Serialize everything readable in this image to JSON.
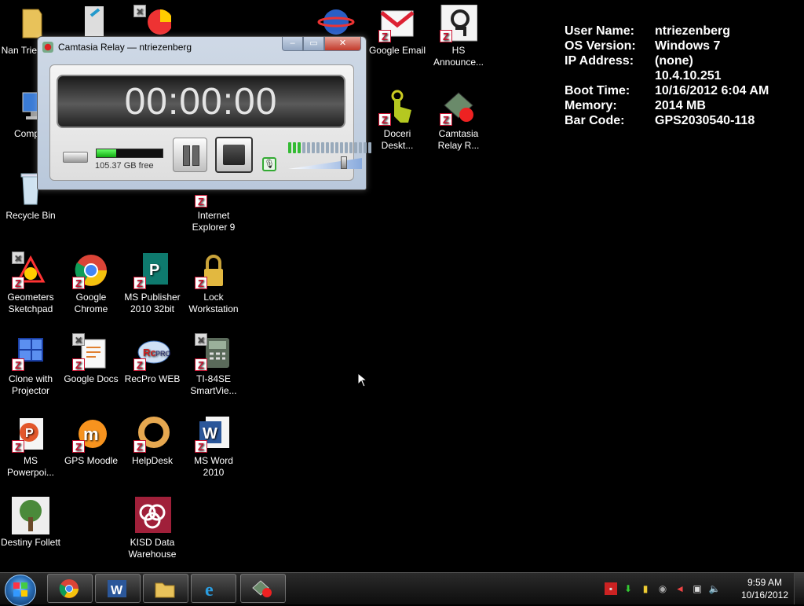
{
  "desktop": {
    "icons": [
      {
        "label": "Nan Triezen..."
      },
      {
        "label": "Comp..."
      },
      {
        "label": "Recycle Bin"
      },
      {
        "label": "Internet Explorer 9"
      },
      {
        "label": "Google Email"
      },
      {
        "label": "HS Announce..."
      },
      {
        "label": "Doceri Deskt..."
      },
      {
        "label": "Camtasia Relay R..."
      },
      {
        "label": "Geometers Sketchpad"
      },
      {
        "label": "Google Chrome"
      },
      {
        "label": "MS Publisher 2010 32bit"
      },
      {
        "label": "Lock Workstation"
      },
      {
        "label": "Clone with Projector"
      },
      {
        "label": "Google Docs"
      },
      {
        "label": "RecPro WEB"
      },
      {
        "label": "TI-84SE SmartVie..."
      },
      {
        "label": "MS Powerpoi..."
      },
      {
        "label": "GPS Moodle"
      },
      {
        "label": "HelpDesk"
      },
      {
        "label": "MS Word 2010"
      },
      {
        "label": "Destiny Follett"
      },
      {
        "label": "KISD Data Warehouse"
      }
    ]
  },
  "sysinfo": {
    "rows": [
      {
        "key": "User Name:",
        "value": "ntriezenberg"
      },
      {
        "key": "OS Version:",
        "value": "Windows 7"
      },
      {
        "key": "IP Address:",
        "value": "(none)"
      },
      {
        "key": "",
        "value": "10.4.10.251"
      },
      {
        "key": "Boot Time:",
        "value": "10/16/2012 6:04 AM"
      },
      {
        "key": "Memory:",
        "value": "2014 MB"
      },
      {
        "key": "Bar Code:",
        "value": "GPS2030540-118"
      }
    ]
  },
  "camtasia": {
    "title": "Camtasia Relay — ntriezenberg",
    "timer": "00:00:00",
    "disk_free": "105.37 GB free",
    "disk_used_fraction": 0.3,
    "mic_level_on": 3,
    "mic_level_total": 18,
    "volume_fraction": 0.75
  },
  "taskbar": {
    "clock_time": "9:59 AM",
    "clock_date": "10/16/2012",
    "apps": [
      "Google Chrome",
      "MS Word 2010",
      "Windows Explorer",
      "Internet Explorer",
      "Camtasia Relay"
    ]
  },
  "colors": {
    "accent_green": "#33bb33",
    "close_red": "#c23a2a",
    "zenworks_red": "#c8102e"
  }
}
